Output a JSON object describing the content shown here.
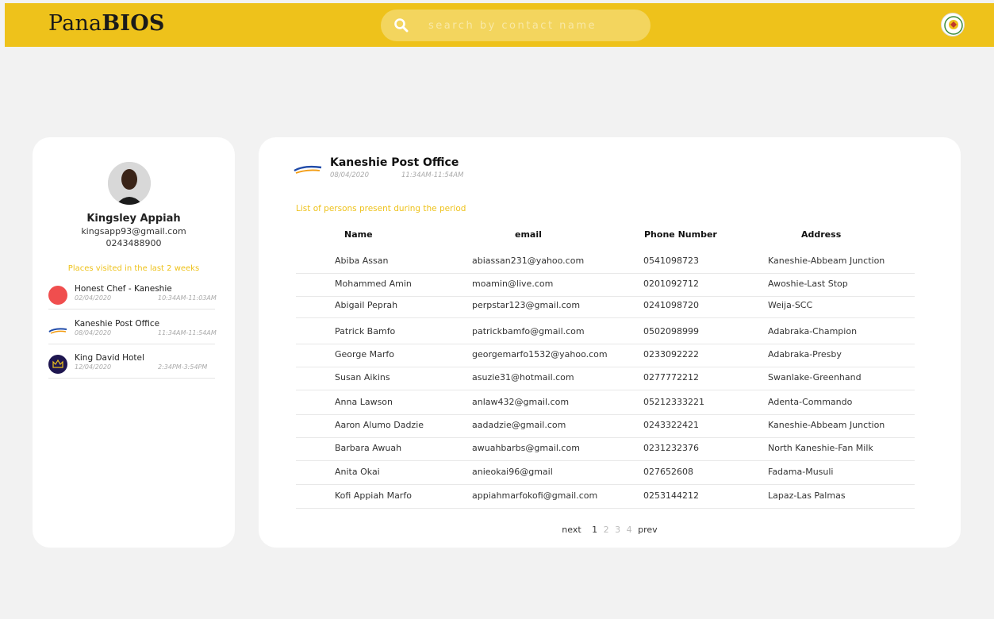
{
  "header": {
    "brand_light": "Pana",
    "brand_bold": "BIOS",
    "search_placeholder": "search by contact name",
    "accent_color": "#eec21b"
  },
  "profile": {
    "name": "Kingsley Appiah",
    "email": "kingsapp93@gmail.com",
    "phone": "0243488900",
    "places_heading": "Places visited in the last 2 weeks",
    "places": [
      {
        "name": "Honest Chef - Kaneshie",
        "date": "02/04/2020",
        "time": "10:34AM-11:03AM",
        "logo_color": "#f04e4e"
      },
      {
        "name": "Kaneshie Post Office",
        "date": "08/04/2020",
        "time": "11:34AM-11:54AM",
        "logo_color": "#ffffff"
      },
      {
        "name": "King David Hotel",
        "date": "12/04/2020",
        "time": "2:34PM-3:54PM",
        "logo_color": "#1e1650"
      }
    ]
  },
  "location": {
    "title": "Kaneshie Post Office",
    "date": "08/04/2020",
    "time": "11:34AM-11:54AM",
    "caption": "List of persons present during the period"
  },
  "table": {
    "columns": [
      "Name",
      "email",
      "Phone Number",
      "Address"
    ],
    "rows": [
      [
        "Abiba Assan",
        "abiassan231@yahoo.com",
        "0541098723",
        "Kaneshie-Abbeam Junction"
      ],
      [
        "Mohammed Amin",
        "moamin@live.com",
        "0201092712",
        "Awoshie-Last Stop"
      ],
      [
        "Abigail Peprah",
        "perpstar123@gmail.com",
        "0241098720",
        "Weija-SCC"
      ],
      [
        "Patrick Bamfo",
        "patrickbamfo@gmail.com",
        "0502098999",
        "Adabraka-Champion"
      ],
      [
        "George Marfo",
        "georgemarfo1532@yahoo.com",
        "0233092222",
        "Adabraka-Presby"
      ],
      [
        "Susan Aikins",
        "asuzie31@hotmail.com",
        "0277772212",
        "Swanlake-Greenhand"
      ],
      [
        "Anna Lawson",
        "anlaw432@gmail.com",
        "05212333221",
        "Adenta-Commando"
      ],
      [
        "Aaron Alumo Dadzie",
        "aadadzie@gmail.com",
        "0243322421",
        "Kaneshie-Abbeam Junction"
      ],
      [
        "Barbara Awuah",
        "awuahbarbs@gmail.com",
        "0231232376",
        "North Kaneshie-Fan Milk"
      ],
      [
        "Anita Okai",
        "anieokai96@gmail",
        "027652608",
        "Fadama-Musuli"
      ],
      [
        "Kofi Appiah Marfo",
        "appiahmarfokofi@gmail.com",
        "0253144212",
        "Lapaz-Las Palmas"
      ]
    ]
  },
  "pagination": {
    "next_label": "next",
    "pages": [
      "1",
      "2",
      "3",
      "4"
    ],
    "current": "1",
    "prev_label": "prev"
  }
}
